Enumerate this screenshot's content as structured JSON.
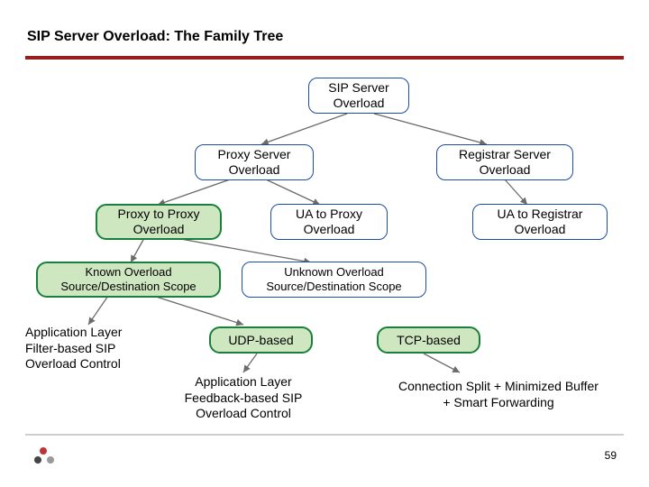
{
  "slide": {
    "title": "SIP Server Overload: The Family Tree",
    "page_num": "59"
  },
  "nodes": {
    "root": "SIP Server\nOverload",
    "proxy_server": "Proxy Server\nOverload",
    "registrar": "Registrar Server\nOverload",
    "p2p": "Proxy to Proxy\nOverload",
    "ua_proxy": "UA to Proxy\nOverload",
    "ua_registrar": "UA to Registrar\nOverload",
    "known": "Known Overload\nSource/Destination Scope",
    "unknown": "Unknown Overload\nSource/Destination Scope",
    "udp": "UDP-based",
    "tcp": "TCP-based",
    "filter": "Application Layer\nFilter-based SIP\nOverload Control",
    "feedback": "Application Layer\nFeedback-based SIP\nOverload Control",
    "connsplit": "Connection Split + Minimized Buffer\n+ Smart Forwarding"
  }
}
